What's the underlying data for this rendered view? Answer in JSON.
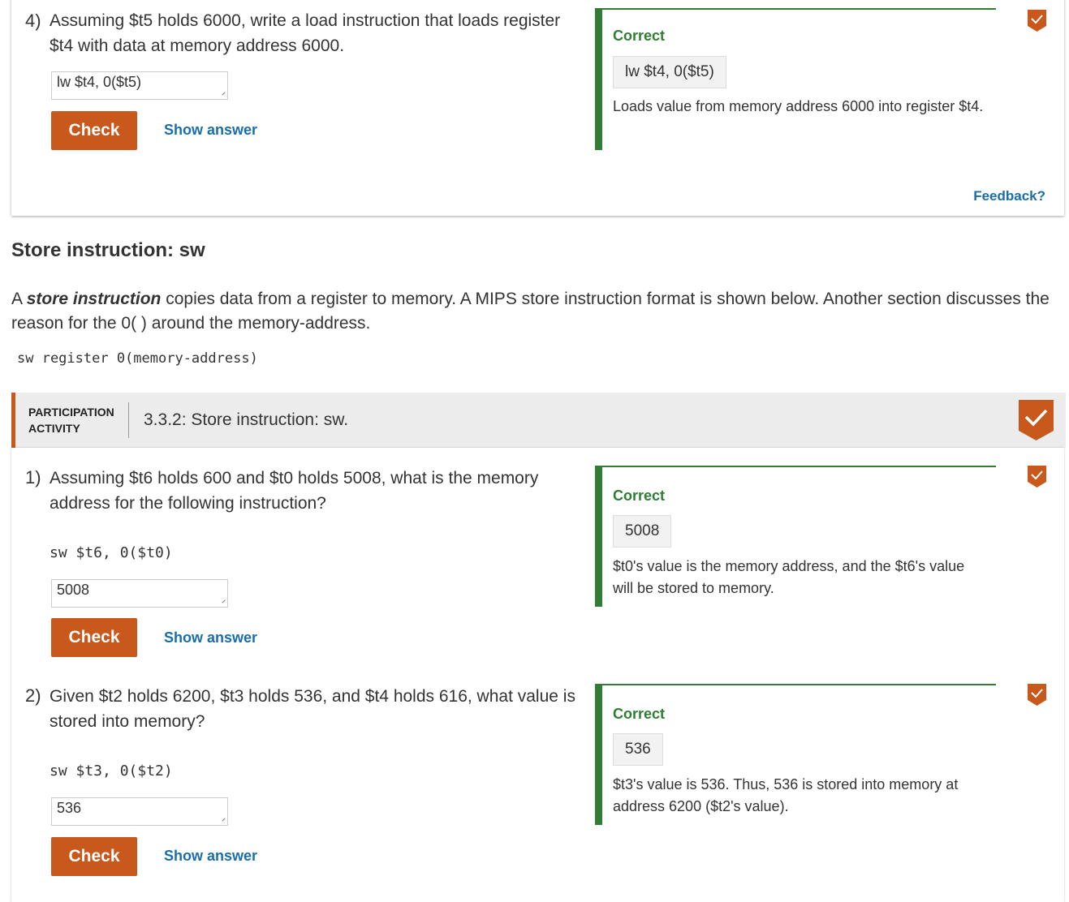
{
  "q4": {
    "number": "4)",
    "text": "Assuming $t5 holds 6000, write a load instruction that loads register $t4 with data at memory address 6000.",
    "input_value": "lw $t4, 0($t5)",
    "check_label": "Check",
    "show_answer_label": "Show answer",
    "feedback": {
      "status": "Correct",
      "answer": "lw $t4, 0($t5)",
      "explanation": "Loads value from memory address 6000 into register $t4."
    },
    "feedback_link": "Feedback?"
  },
  "section": {
    "heading": "Store instruction: sw",
    "para_prefix": "A ",
    "para_term": "store instruction",
    "para_rest": " copies data from a register to memory. A MIPS store instruction format is shown below. Another section discusses the reason for the 0( ) around the memory-address.",
    "format": "sw register 0(memory-address)"
  },
  "activity": {
    "label_line1": "PARTICIPATION",
    "label_line2": "ACTIVITY",
    "title": "3.3.2: Store instruction: sw.",
    "questions": [
      {
        "number": "1)",
        "text": "Assuming $t6 holds 600 and $t0 holds 5008, what is the memory address for the following instruction?",
        "code": "sw $t6, 0($t0)",
        "input_value": "5008",
        "check_label": "Check",
        "show_answer_label": "Show answer",
        "feedback": {
          "status": "Correct",
          "answer": "5008",
          "explanation": "$t0's value is the memory address, and the $t6's value will be stored to memory."
        }
      },
      {
        "number": "2)",
        "text": "Given $t2 holds 6200, $t3 holds 536, and $t4 holds 616, what value is stored into memory?",
        "code": "sw $t3, 0($t2)",
        "input_value": "536",
        "check_label": "Check",
        "show_answer_label": "Show answer",
        "feedback": {
          "status": "Correct",
          "answer": "536",
          "explanation": "$t3's value is 536. Thus, 536 is stored into memory at address 6200 ($t2's value)."
        }
      }
    ]
  },
  "colors": {
    "accent": "#c8581b",
    "correct": "#2e7d32",
    "link": "#1a6ea8"
  }
}
